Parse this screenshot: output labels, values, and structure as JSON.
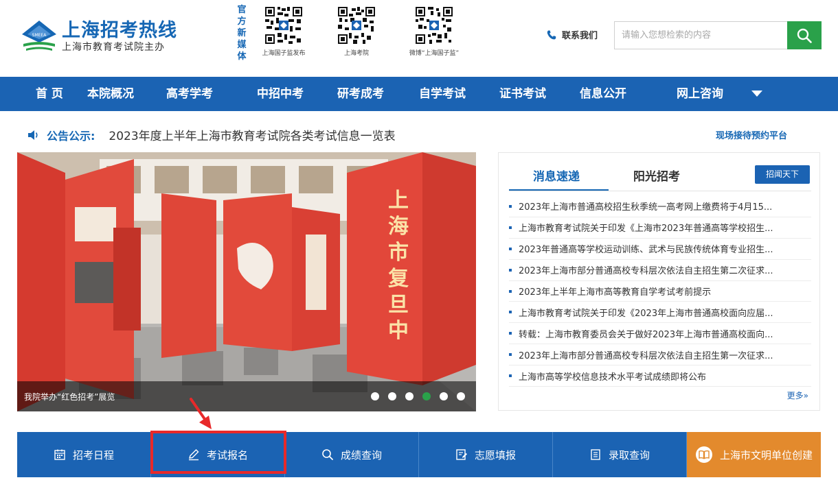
{
  "header": {
    "title": "上海招考热线",
    "subtitle": "上海市教育考试院主办",
    "media_label": "官方新媒体",
    "qr_codes": [
      {
        "caption": "上海国子监发布"
      },
      {
        "caption": "上海考院"
      },
      {
        "caption": "微博“上海国子监”"
      }
    ],
    "contact": "联系我们",
    "search_placeholder": "请输入您想检索的内容",
    "icons": {
      "logo": "smeea-emblem-icon",
      "phone": "phone-icon",
      "search": "search-icon"
    }
  },
  "nav": {
    "items": [
      "首 页",
      "本院概况",
      "高考学考",
      "中招中考",
      "研考成考",
      "自学考试",
      "证书考试",
      "信息公开",
      "网上咨询"
    ]
  },
  "notice": {
    "label": "公告公示:",
    "text": "2023年度上半年上海市教育考试院各类考试信息一览表",
    "appointment_link": "现场接待预约平台"
  },
  "slider": {
    "caption": "我院举办“红色招考”展览",
    "dot_count": 6,
    "active_dot": 4
  },
  "news": {
    "tabs": [
      "消息速递",
      "阳光招考"
    ],
    "active_tab": 0,
    "button": "招闻天下",
    "items": [
      "2023年上海市普通高校招生秋季统一高考网上缴费将于4月15...",
      "上海市教育考试院关于印发《上海市2023年普通高等学校招生...",
      "2023年普通高等学校运动训练、武术与民族传统体育专业招生...",
      "2023年上海市部分普通高校专科层次依法自主招生第二次征求...",
      "2023年上半年上海市高等教育自学考试考前提示",
      "上海市教育考试院关于印发《2023年上海市普通高校面向应届...",
      "转载：上海市教育委员会关于做好2023年上海市普通高校面向...",
      "2023年上海市部分普通高校专科层次依法自主招生第一次征求...",
      "上海市高等学校信息技术水平考试成绩即将公布"
    ],
    "more": "更多»"
  },
  "bottom_bar": {
    "items": [
      {
        "label": "招考日程",
        "icon": "calendar-icon"
      },
      {
        "label": "考试报名",
        "icon": "pencil-icon"
      },
      {
        "label": "成绩查询",
        "icon": "magnifier-icon"
      },
      {
        "label": "志愿填报",
        "icon": "form-edit-icon"
      },
      {
        "label": "录取查询",
        "icon": "list-icon"
      },
      {
        "label": "上海市文明单位创建",
        "icon": "book-icon"
      }
    ],
    "highlighted": "考试报名"
  },
  "colors": {
    "brand_blue": "#1b63b3",
    "title_blue": "#1667b4",
    "search_green": "#2aa14a",
    "orange": "#e38a2d",
    "highlight_red": "#e8292a"
  }
}
